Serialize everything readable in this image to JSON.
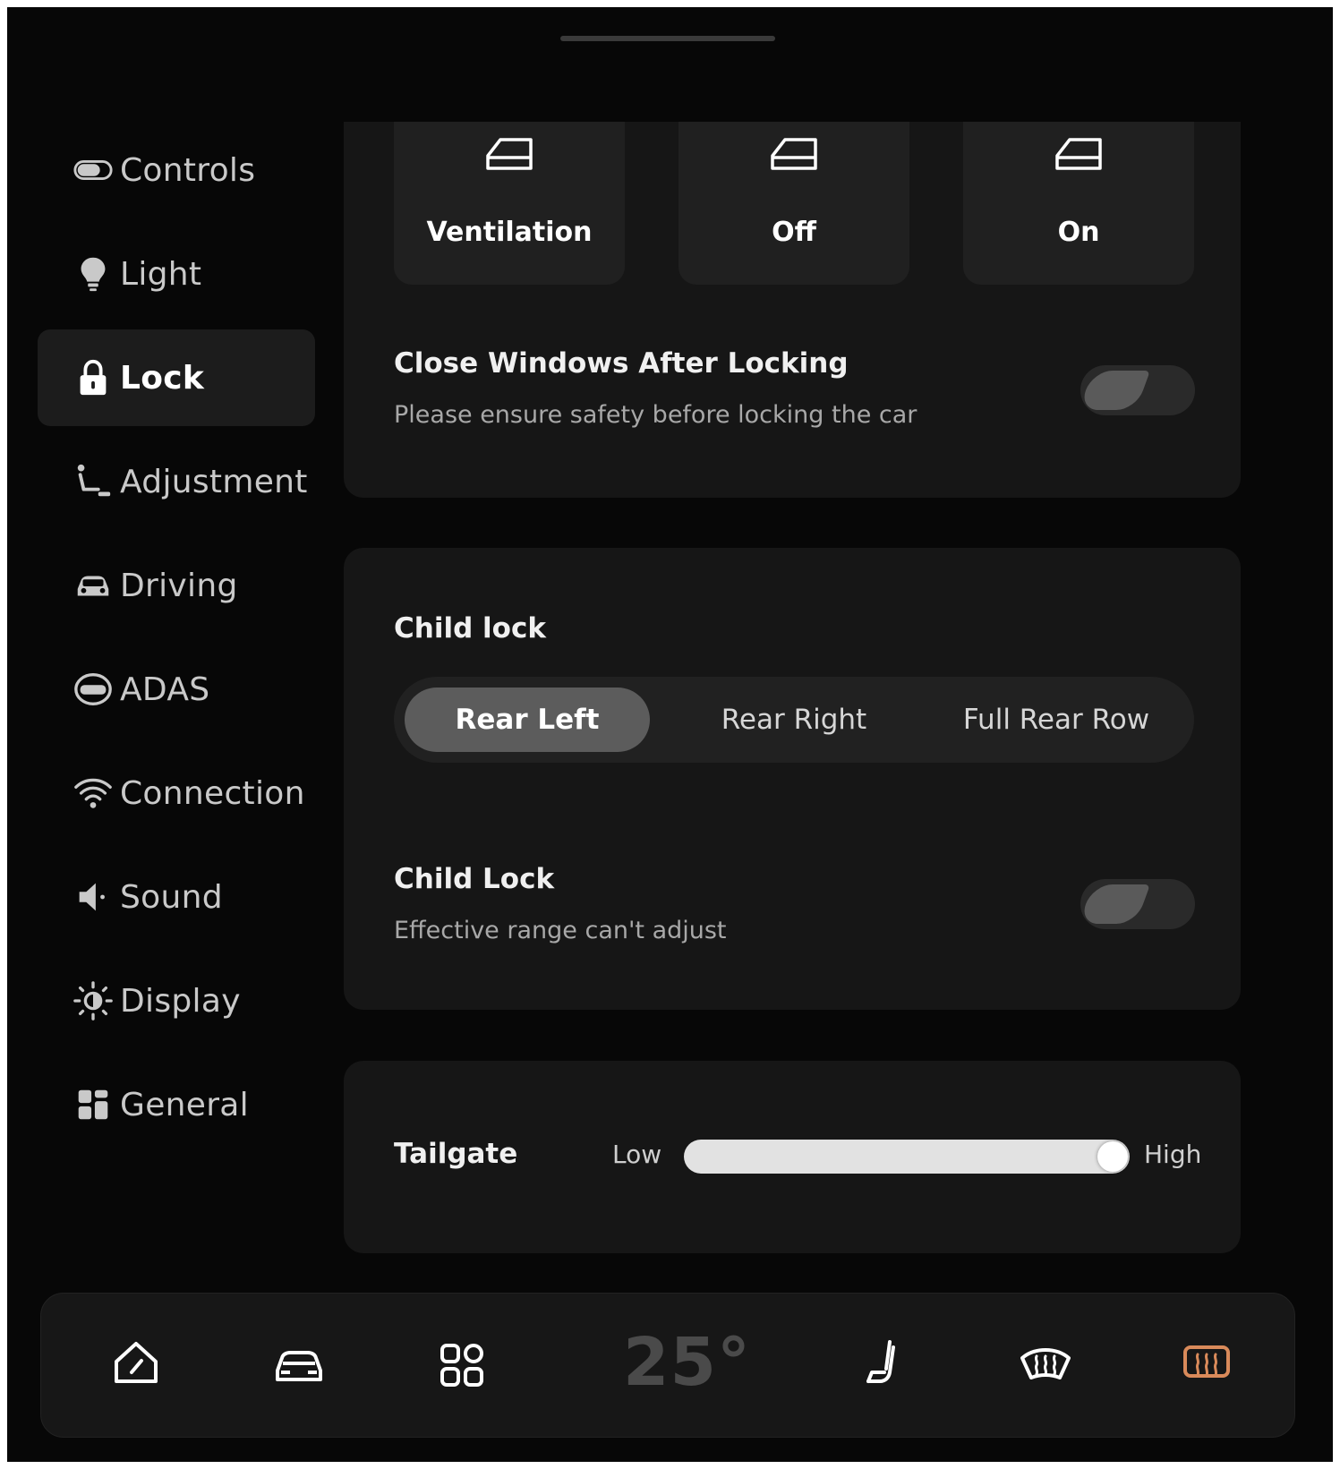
{
  "sidebar": {
    "items": [
      {
        "label": "Controls",
        "icon": "controls-icon"
      },
      {
        "label": "Light",
        "icon": "bulb-icon"
      },
      {
        "label": "Lock",
        "icon": "lock-icon",
        "active": true
      },
      {
        "label": "Adjustment",
        "icon": "seat-adjust-icon"
      },
      {
        "label": "Driving",
        "icon": "car-icon"
      },
      {
        "label": "ADAS",
        "icon": "adas-icon"
      },
      {
        "label": "Connection",
        "icon": "wifi-icon"
      },
      {
        "label": "Sound",
        "icon": "speaker-icon"
      },
      {
        "label": "Display",
        "icon": "brightness-icon"
      },
      {
        "label": "General",
        "icon": "grid-icon"
      }
    ]
  },
  "window_mode": {
    "options": [
      {
        "label": "Ventilation",
        "icon": "window-icon"
      },
      {
        "label": "Off",
        "icon": "window-icon"
      },
      {
        "label": "On",
        "icon": "window-icon"
      }
    ]
  },
  "close_windows": {
    "title": "Close Windows After Locking",
    "subtitle": "Please ensure safety before locking the car",
    "enabled": false
  },
  "child_lock_section": {
    "title": "Child lock",
    "options": [
      "Rear Left",
      "Rear Right",
      "Full Rear Row"
    ],
    "selected": "Rear Left"
  },
  "child_lock_toggle": {
    "title": "Child Lock",
    "subtitle": "Effective range can't adjust",
    "enabled": false
  },
  "tailgate": {
    "label": "Tailgate",
    "min_label": "Low",
    "max_label": "High",
    "value_fraction": 1.0
  },
  "dock": {
    "temperature": "25°",
    "buttons": [
      "home-icon",
      "car-icon",
      "apps-icon",
      "seat-icon",
      "front-defrost-icon",
      "rear-defrost-icon"
    ],
    "rear_defrost_color": "#d98a5a"
  }
}
